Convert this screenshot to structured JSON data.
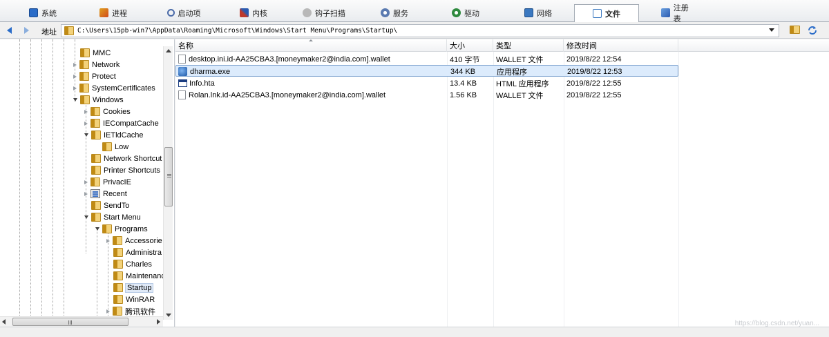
{
  "tabs": [
    {
      "label": "系统",
      "icon": "monitor-icon",
      "color": "#2a6cc8"
    },
    {
      "label": "进程",
      "icon": "process-icon",
      "color": "#d04a1a"
    },
    {
      "label": "启动项",
      "icon": "startup-icon",
      "color": "#4a6aa8"
    },
    {
      "label": "内核",
      "icon": "kernel-icon",
      "color": "#c0392b"
    },
    {
      "label": "钩子扫描",
      "icon": "hook-icon",
      "color": "#7a7a7a"
    },
    {
      "label": "服务",
      "icon": "service-icon",
      "color": "#5a7ab0"
    },
    {
      "label": "驱动",
      "icon": "driver-icon",
      "color": "#2e8a3e"
    },
    {
      "label": "网络",
      "icon": "network-icon",
      "color": "#3a78c0"
    },
    {
      "label": "文件",
      "icon": "file-icon",
      "color": "#3a78c0"
    },
    {
      "label": "注册表",
      "icon": "registry-icon",
      "color": "#3a78c0"
    }
  ],
  "active_tab": "文件",
  "address": {
    "label": "地址",
    "path": "C:\\Users\\15pb-win7\\AppData\\Roaming\\Microsoft\\Windows\\Start Menu\\Programs\\Startup\\"
  },
  "tree": [
    {
      "label": "MMC"
    },
    {
      "label": "Network"
    },
    {
      "label": "Protect"
    },
    {
      "label": "SystemCertificates"
    },
    {
      "label": "Windows"
    },
    {
      "label": "Cookies"
    },
    {
      "label": "IECompatCache"
    },
    {
      "label": "IETldCache"
    },
    {
      "label": "Low"
    },
    {
      "label": "Network Shortcut"
    },
    {
      "label": "Printer Shortcuts"
    },
    {
      "label": "PrivacIE"
    },
    {
      "label": "Recent"
    },
    {
      "label": "SendTo"
    },
    {
      "label": "Start Menu"
    },
    {
      "label": "Programs"
    },
    {
      "label": "Accessorie"
    },
    {
      "label": "Administra"
    },
    {
      "label": "Charles"
    },
    {
      "label": "Maintenanc"
    },
    {
      "label": "Startup"
    },
    {
      "label": "WinRAR"
    },
    {
      "label": "腾讯软件"
    }
  ],
  "columns": [
    "名称",
    "大小",
    "类型",
    "修改时间"
  ],
  "files": [
    {
      "name": "desktop.ini.id-AA25CBA3.[moneymaker2@india.com].wallet",
      "size": "410 字节",
      "type": "WALLET 文件",
      "modified": "2019/8/22 12:54",
      "icon": "document-icon"
    },
    {
      "name": "dharma.exe",
      "size": "344 KB",
      "type": "应用程序",
      "modified": "2019/8/22 12:53",
      "icon": "executable-icon"
    },
    {
      "name": "Info.hta",
      "size": "13.4 KB",
      "type": "HTML 应用程序",
      "modified": "2019/8/22 12:55",
      "icon": "hta-window-icon"
    },
    {
      "name": "Rolan.lnk.id-AA25CBA3.[moneymaker2@india.com].wallet",
      "size": "1.56 KB",
      "type": "WALLET 文件",
      "modified": "2019/8/22 12:55",
      "icon": "document-icon"
    }
  ],
  "selected_file": "dharma.exe",
  "watermark": "https://blog.csdn.net/yuan...",
  "colors": {
    "selection": "#dcebfc",
    "selection_border": "#7da2ce",
    "folder": "#f3d27a"
  }
}
